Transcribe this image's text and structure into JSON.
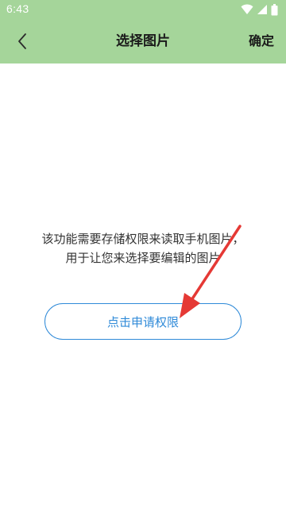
{
  "status_bar": {
    "time": "6:43",
    "icons": [
      "wifi-icon",
      "cellular-signal-icon",
      "battery-icon"
    ]
  },
  "app_bar": {
    "title": "选择图片",
    "back_icon": "chevron-left-icon",
    "confirm_label": "确定",
    "background_color": "#a5d59a"
  },
  "main": {
    "message_line1": "该功能需要存储权限来读取手机图片，",
    "message_line2": "用于让您来选择要编辑的图片",
    "request_button_label": "点击申请权限",
    "accent_color": "#2f8ad8"
  },
  "annotation": {
    "icon": "red-arrow-icon",
    "color": "#e53935"
  }
}
